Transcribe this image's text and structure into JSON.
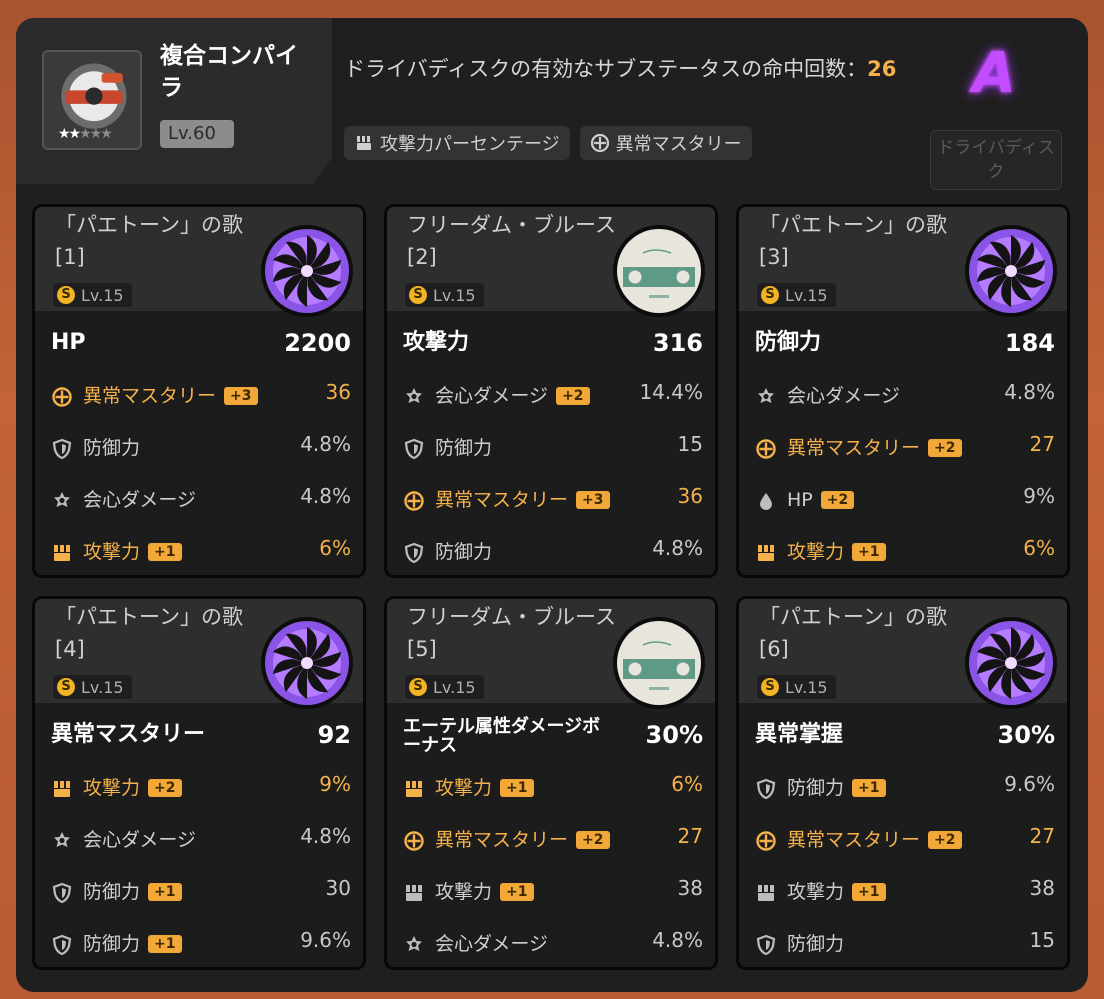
{
  "header": {
    "disc_name": "複合コンパイラ",
    "level": "Lv.60",
    "stars_filled": "★★",
    "stars_empty": "★★★",
    "summary_prefix": "ドライバディスクの有効なサブステータスの命中回数：",
    "hit_count": "26",
    "effective_stats": [
      "攻撃力パーセンテージ",
      "異常マスタリー"
    ],
    "rank": "A",
    "drive_disc_button": "ドライバディスク"
  },
  "colors": {
    "accent": "#f5b14a",
    "rank": "#c24dff",
    "panel": "#1f1f1f"
  },
  "cards": [
    {
      "title": "「パエトーン」の歌[1]",
      "level": "Lv.15",
      "disc_icon": "phaethon-disc-icon",
      "main_stat": {
        "name": "HP",
        "value": "2200"
      },
      "sub_stats": [
        {
          "icon": "mastery-icon",
          "name": "異常マスタリー",
          "roll": "+3",
          "value": "36",
          "hit": true
        },
        {
          "icon": "shield-icon",
          "name": "防御力",
          "roll": "",
          "value": "4.8%",
          "hit": false
        },
        {
          "icon": "crit-icon",
          "name": "会心ダメージ",
          "roll": "",
          "value": "4.8%",
          "hit": false
        },
        {
          "icon": "fist-icon",
          "name": "攻撃力",
          "roll": "+1",
          "value": "6%",
          "hit": true
        }
      ]
    },
    {
      "title": "フリーダム・ブルース[2]",
      "level": "Lv.15",
      "disc_icon": "freedom-disc-icon",
      "main_stat": {
        "name": "攻撃力",
        "value": "316"
      },
      "sub_stats": [
        {
          "icon": "crit-icon",
          "name": "会心ダメージ",
          "roll": "+2",
          "value": "14.4%",
          "hit": false
        },
        {
          "icon": "shield-icon",
          "name": "防御力",
          "roll": "",
          "value": "15",
          "hit": false
        },
        {
          "icon": "mastery-icon",
          "name": "異常マスタリー",
          "roll": "+3",
          "value": "36",
          "hit": true
        },
        {
          "icon": "shield-icon",
          "name": "防御力",
          "roll": "",
          "value": "4.8%",
          "hit": false
        }
      ]
    },
    {
      "title": "「パエトーン」の歌[3]",
      "level": "Lv.15",
      "disc_icon": "phaethon-disc-icon",
      "main_stat": {
        "name": "防御力",
        "value": "184"
      },
      "sub_stats": [
        {
          "icon": "crit-icon",
          "name": "会心ダメージ",
          "roll": "",
          "value": "4.8%",
          "hit": false
        },
        {
          "icon": "mastery-icon",
          "name": "異常マスタリー",
          "roll": "+2",
          "value": "27",
          "hit": true
        },
        {
          "icon": "drop-icon",
          "name": "HP",
          "roll": "+2",
          "value": "9%",
          "hit": false
        },
        {
          "icon": "fist-icon",
          "name": "攻撃力",
          "roll": "+1",
          "value": "6%",
          "hit": true
        }
      ]
    },
    {
      "title": "「パエトーン」の歌[4]",
      "level": "Lv.15",
      "disc_icon": "phaethon-disc-icon",
      "main_stat": {
        "name": "異常マスタリー",
        "value": "92"
      },
      "sub_stats": [
        {
          "icon": "fist-icon",
          "name": "攻撃力",
          "roll": "+2",
          "value": "9%",
          "hit": true
        },
        {
          "icon": "crit-icon",
          "name": "会心ダメージ",
          "roll": "",
          "value": "4.8%",
          "hit": false
        },
        {
          "icon": "shield-icon",
          "name": "防御力",
          "roll": "+1",
          "value": "30",
          "hit": false
        },
        {
          "icon": "shield-icon",
          "name": "防御力",
          "roll": "+1",
          "value": "9.6%",
          "hit": false
        }
      ]
    },
    {
      "title": "フリーダム・ブルース[5]",
      "level": "Lv.15",
      "disc_icon": "freedom-disc-icon",
      "main_stat": {
        "name": "エーテル属性ダメージボーナス",
        "value": "30%",
        "two_line": true
      },
      "sub_stats": [
        {
          "icon": "fist-icon",
          "name": "攻撃力",
          "roll": "+1",
          "value": "6%",
          "hit": true
        },
        {
          "icon": "mastery-icon",
          "name": "異常マスタリー",
          "roll": "+2",
          "value": "27",
          "hit": true
        },
        {
          "icon": "fist-icon",
          "name": "攻撃力",
          "roll": "+1",
          "value": "38",
          "hit": false
        },
        {
          "icon": "crit-icon",
          "name": "会心ダメージ",
          "roll": "",
          "value": "4.8%",
          "hit": false
        }
      ]
    },
    {
      "title": "「パエトーン」の歌[6]",
      "level": "Lv.15",
      "disc_icon": "phaethon-disc-icon",
      "main_stat": {
        "name": "異常掌握",
        "value": "30%"
      },
      "sub_stats": [
        {
          "icon": "shield-icon",
          "name": "防御力",
          "roll": "+1",
          "value": "9.6%",
          "hit": false
        },
        {
          "icon": "mastery-icon",
          "name": "異常マスタリー",
          "roll": "+2",
          "value": "27",
          "hit": true
        },
        {
          "icon": "fist-icon",
          "name": "攻撃力",
          "roll": "+1",
          "value": "38",
          "hit": false
        },
        {
          "icon": "shield-icon",
          "name": "防御力",
          "roll": "",
          "value": "15",
          "hit": false
        }
      ]
    }
  ]
}
